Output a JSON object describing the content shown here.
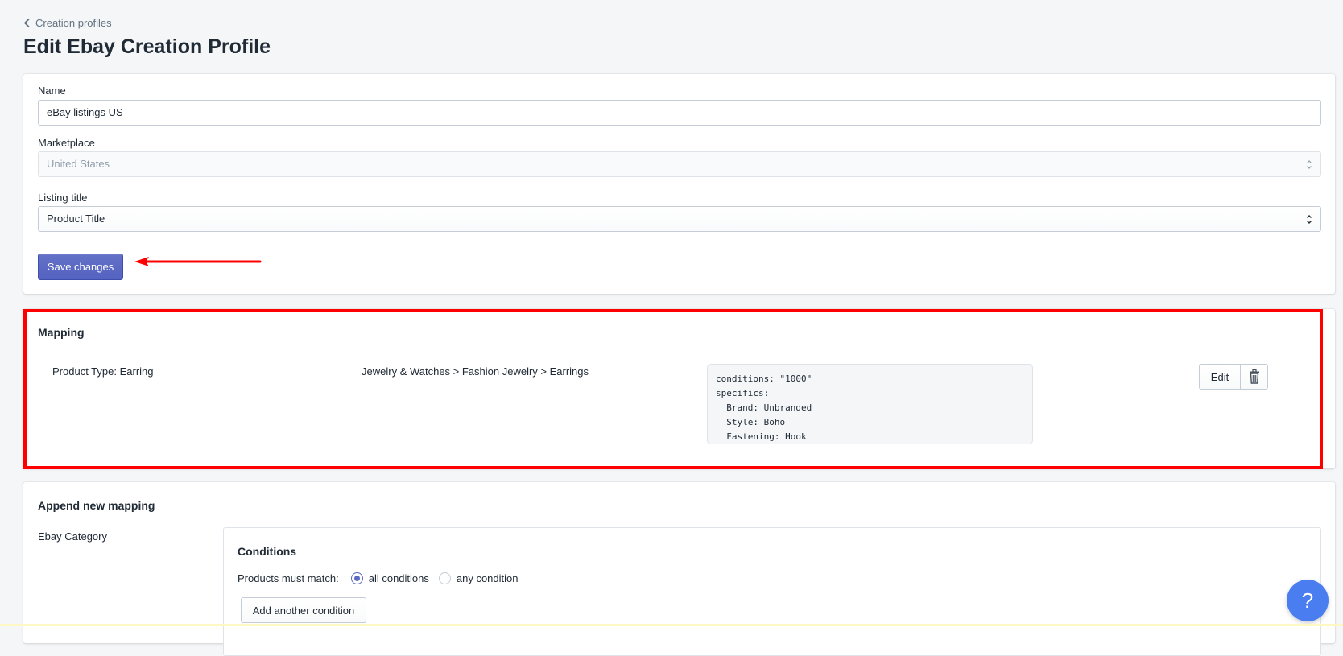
{
  "breadcrumb": {
    "label": "Creation profiles"
  },
  "page": {
    "title": "Edit Ebay Creation Profile"
  },
  "form": {
    "name_label": "Name",
    "name_value": "eBay listings US",
    "marketplace_label": "Marketplace",
    "marketplace_value": "United States",
    "listing_title_label": "Listing title",
    "listing_title_value": "Product Title",
    "save_label": "Save changes"
  },
  "mapping": {
    "title": "Mapping",
    "rows": [
      {
        "product_type": "Product Type: Earring",
        "category": "Jewelry & Watches > Fashion Jewelry > Earrings",
        "config": "conditions: \"1000\"\nspecifics:\n  Brand: Unbranded\n  Style: Boho\n  Fastening: Hook",
        "edit_label": "Edit"
      }
    ]
  },
  "append": {
    "title": "Append new mapping",
    "category_label": "Ebay Category",
    "conditions_title": "Conditions",
    "match_label": "Products must match:",
    "option_all": "all conditions",
    "option_any": "any condition",
    "selected_option": "all conditions",
    "add_condition_label": "Add another condition"
  },
  "help": {
    "label": "?"
  },
  "colors": {
    "primary": "#5c6ac4",
    "highlight": "#ff0000",
    "help": "#4a7ef0"
  },
  "icons": [
    "chevron-left-icon",
    "select-arrows-icon",
    "trash-icon",
    "red-arrow-annotation",
    "question-icon"
  ]
}
